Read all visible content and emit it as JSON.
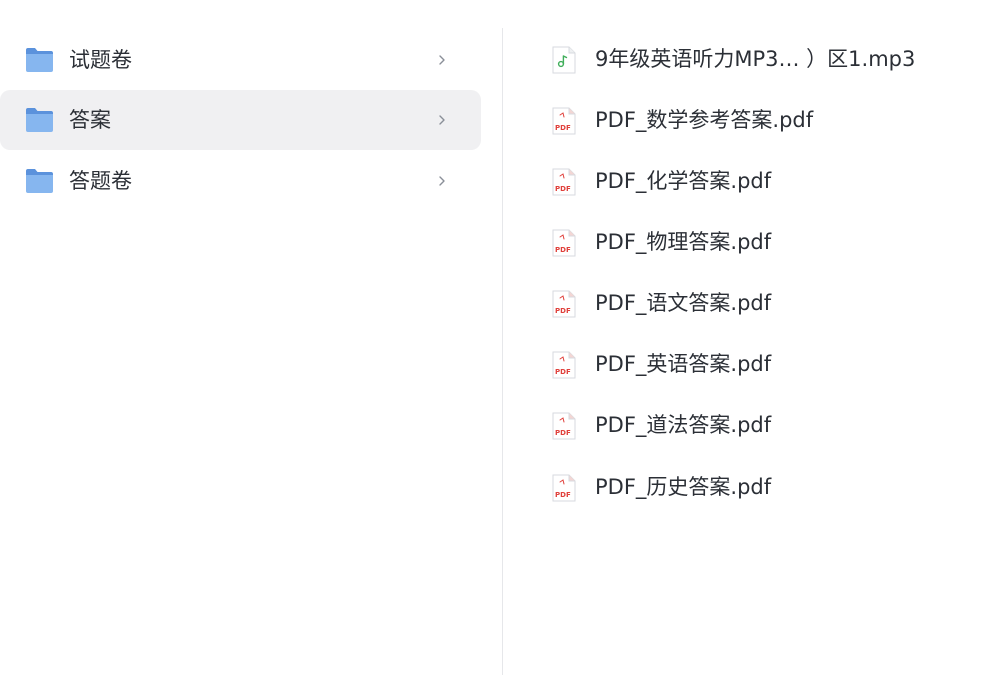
{
  "folders": [
    {
      "label": "试题卷",
      "selected": false
    },
    {
      "label": "答案",
      "selected": true
    },
    {
      "label": "答题卷",
      "selected": false
    }
  ],
  "files": [
    {
      "label": "9年级英语听力MP3…  ）区1.mp3",
      "type": "audio"
    },
    {
      "label": "PDF_数学参考答案.pdf",
      "type": "pdf"
    },
    {
      "label": "PDF_化学答案.pdf",
      "type": "pdf"
    },
    {
      "label": "PDF_物理答案.pdf",
      "type": "pdf"
    },
    {
      "label": "PDF_语文答案.pdf",
      "type": "pdf"
    },
    {
      "label": "PDF_英语答案.pdf",
      "type": "pdf"
    },
    {
      "label": "PDF_道法答案.pdf",
      "type": "pdf"
    },
    {
      "label": "PDF_历史答案.pdf",
      "type": "pdf"
    }
  ],
  "colors": {
    "folder": "#6fa3e6",
    "selected_bg": "#f0f0f2",
    "pdf_red": "#e0403b",
    "audio_green": "#3fae5a",
    "text": "#2b2f36"
  }
}
